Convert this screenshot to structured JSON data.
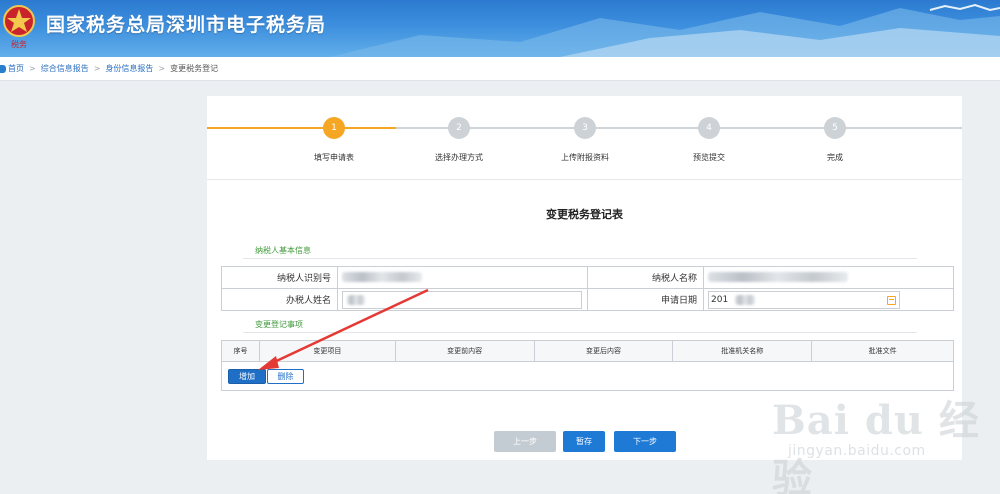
{
  "header": {
    "emblem_text": "税务",
    "title": "国家税务总局深圳市电子税务局"
  },
  "breadcrumb": {
    "items": [
      "首页",
      "综合信息报告",
      "身份信息报告",
      "变更税务登记"
    ],
    "separator": ">"
  },
  "steps": [
    {
      "num": "1",
      "label": "填写申请表",
      "state": "active"
    },
    {
      "num": "2",
      "label": "选择办理方式",
      "state": "todo"
    },
    {
      "num": "3",
      "label": "上传附报资料",
      "state": "todo"
    },
    {
      "num": "4",
      "label": "预览提交",
      "state": "todo"
    },
    {
      "num": "5",
      "label": "完成",
      "state": "todo"
    }
  ],
  "form": {
    "title": "变更税务登记表",
    "basic_section": "纳税人基本信息",
    "taxpayer_id_label": "纳税人识别号",
    "taxpayer_name_label": "纳税人名称",
    "handler_name_label": "办税人姓名",
    "apply_date_label": "申请日期",
    "apply_date_value": "201",
    "change_section": "变更登记事项",
    "columns": [
      "序号",
      "变更项目",
      "变更前内容",
      "变更后内容",
      "批准机关名称",
      "批准文件"
    ],
    "add_label": "增加",
    "delete_label": "删除"
  },
  "nav": {
    "prev": "上一步",
    "save": "暂存",
    "next": "下一步"
  },
  "watermark": {
    "logo": "Bai du 经验",
    "url": "jingyan.baidu.com"
  },
  "colors": {
    "accent": "#1f7ad6",
    "step_active": "#f5a623",
    "section": "#3f9a3a",
    "arrow": "#e53935"
  }
}
